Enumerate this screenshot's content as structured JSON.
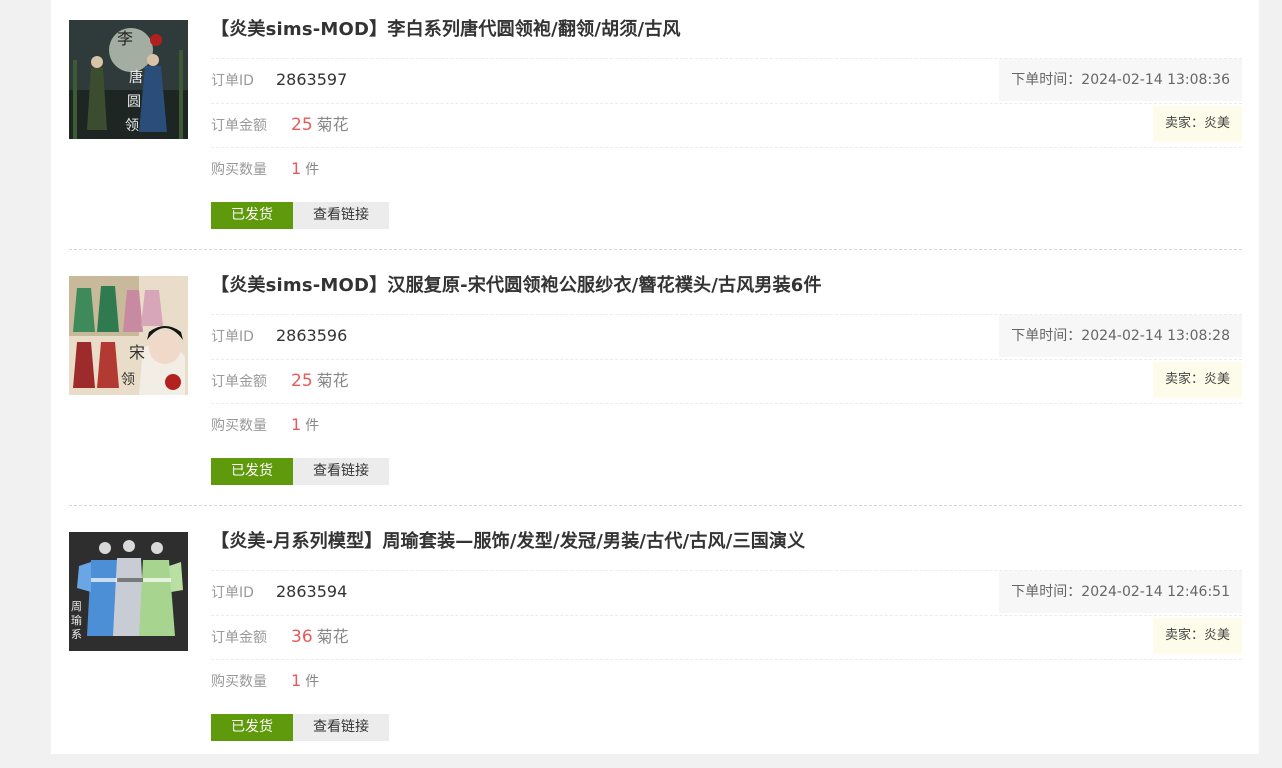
{
  "labels": {
    "order_id": "订单ID",
    "amount": "订单金额",
    "quantity": "购买数量",
    "time_prefix": "下单时间：",
    "seller_prefix": "卖家：",
    "currency": "菊花",
    "qty_unit": "件",
    "status": "已发货",
    "view_link": "查看链接"
  },
  "orders": [
    {
      "title": "【炎美sims-MOD】李白系列唐代圆领袍/翻领/胡须/古风",
      "id": "2863597",
      "time": "2024-02-14 13:08:36",
      "price": "25",
      "seller": "炎美",
      "qty": "1",
      "thumb_icon": "libai-tang-robe-thumbnail"
    },
    {
      "title": "【炎美sims-MOD】汉服复原-宋代圆领袍公服纱衣/簪花襆头/古风男装6件",
      "id": "2863596",
      "time": "2024-02-14 13:08:28",
      "price": "25",
      "seller": "炎美",
      "qty": "1",
      "thumb_icon": "song-round-collar-robe-thumbnail"
    },
    {
      "title": "【炎美-月系列模型】周瑜套装—服饰/发型/发冠/男装/古代/古风/三国演义",
      "id": "2863594",
      "time": "2024-02-14 12:46:51",
      "price": "36",
      "seller": "炎美",
      "qty": "1",
      "thumb_icon": "zhouyu-costume-thumbnail"
    }
  ],
  "colors": {
    "shipped_button": "#5f9a0c",
    "price_red": "#e65a5a",
    "seller_bg": "#fdfbe9"
  }
}
